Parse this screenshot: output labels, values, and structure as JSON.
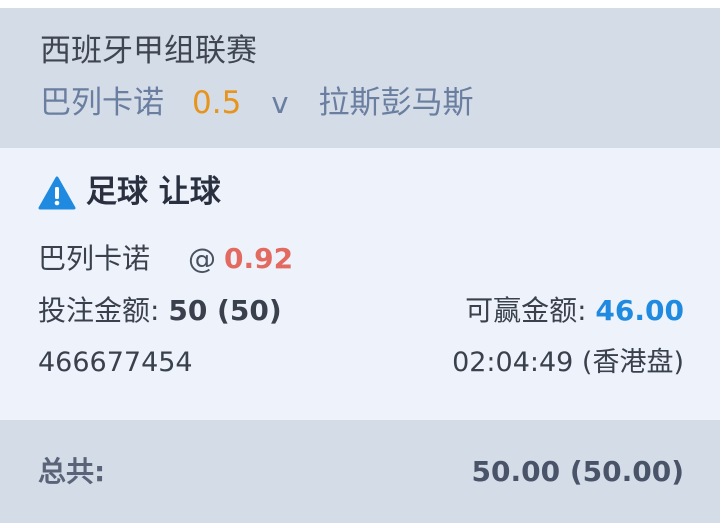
{
  "header": {
    "league": "西班牙甲组联赛",
    "home_team": "巴列卡诺",
    "handicap": "0.5",
    "vs": "v",
    "away_team": "拉斯彭马斯"
  },
  "bet": {
    "icon": "warning-icon",
    "type": "足球 让球",
    "selection": "巴列卡诺",
    "at": "@",
    "odds": "0.92",
    "stake_label": "投注金额:",
    "stake_value": "50 (50)",
    "win_label": "可赢金额:",
    "win_value": "46.00",
    "ticket_id": "466677454",
    "time": "02:04:49 (香港盘)"
  },
  "footer": {
    "total_label": "总共:",
    "total_value": "50.00 (50.00)"
  },
  "colors": {
    "header_bg": "#d4dce8",
    "body_bg": "#eef3fb",
    "handicap": "#e8941a",
    "odds": "#e36a60",
    "win_value": "#1f8ae0",
    "warning": "#1f8ae0"
  }
}
